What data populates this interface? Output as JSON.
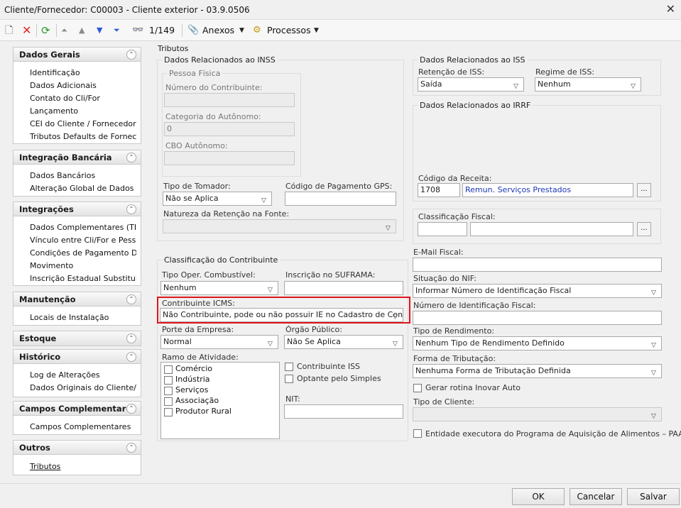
{
  "window": {
    "title": "Cliente/Fornecedor: C00003 - Cliente exterior - 03.9.0506"
  },
  "toolbar": {
    "record_position": "1/149",
    "attachments_label": "Anexos",
    "processes_label": "Processos"
  },
  "sidebar": {
    "sections": [
      {
        "title": "Dados Gerais",
        "items": [
          "Identificação",
          "Dados Adicionais",
          "Contato do Cli/For",
          "Lançamento",
          "CEI do Cliente / Fornecedor",
          "Tributos Defaults de Fornec..."
        ]
      },
      {
        "title": "Integração Bancária",
        "items": [
          "Dados Bancários",
          "Alteração Global de Dados B..."
        ]
      },
      {
        "title": "Integrações",
        "items": [
          "Dados Complementares (TIN)",
          "Vínculo entre Cli/For e Pessoa",
          "Condições de Pagamento De...",
          "Movimento",
          "Inscrição Estadual Substituiç..."
        ]
      },
      {
        "title": "Manutenção",
        "items": [
          "Locais de Instalação"
        ]
      },
      {
        "title": "Estoque",
        "items": []
      },
      {
        "title": "Histórico",
        "items": [
          "Log de Alterações",
          "Dados Originais do Cliente/F..."
        ]
      },
      {
        "title": "Campos Complementares",
        "items": [
          "Campos Complementares"
        ]
      },
      {
        "title": "Outros",
        "items": [
          "Tributos"
        ]
      }
    ]
  },
  "main": {
    "title": "Tributos",
    "inss": {
      "group_title": "Dados Relacionados ao INSS",
      "pf_title": "Pessoa Física",
      "num_contrib_label": "Número do Contribuinte:",
      "num_contrib_value": "",
      "cat_autonomo_label": "Categoria do Autônomo:",
      "cat_autonomo_value": "0",
      "cbo_label": "CBO Autônomo:",
      "cbo_value": "",
      "tomador_label": "Tipo de Tomador:",
      "tomador_value": "Não se Aplica",
      "gps_label": "Código de Pagamento GPS:",
      "gps_value": "",
      "natureza_label": "Natureza da Retenção na Fonte:",
      "natureza_value": ""
    },
    "classif": {
      "group_title": "Classificação do Contribuinte",
      "combustivel_label": "Tipo Oper. Combustível:",
      "combustivel_value": "Nenhum",
      "suframa_label": "Inscrição no SUFRAMA:",
      "suframa_value": "",
      "icms_label": "Contribuinte ICMS:",
      "icms_value": "Não Contribuinte, pode ou não possuir IE no Cadastro de Contribu",
      "porte_label": "Porte da Empresa:",
      "porte_value": "Normal",
      "orgao_label": "Órgão Público:",
      "orgao_value": "Não Se Aplica",
      "ramo_label": "Ramo de Atividade:",
      "ramos": [
        "Comércio",
        "Indústria",
        "Serviços",
        "Associação",
        "Produtor Rural"
      ],
      "contrib_iss_label": "Contribuinte ISS",
      "simples_label": "Optante pelo Simples",
      "nit_label": "NIT:",
      "nit_value": ""
    },
    "iss": {
      "group_title": "Dados Relacionados ao ISS",
      "retencao_label": "Retenção de ISS:",
      "retencao_value": "Saída",
      "regime_label": "Regime de ISS:",
      "regime_value": "Nenhum"
    },
    "irrf": {
      "group_title": "Dados Relacionados ao IRRF",
      "codigo_label": "Código da Receita:",
      "codigo_value": "1708",
      "codigo_desc": "Remun. Serviços Prestados"
    },
    "fiscal": {
      "classif_label": "Classificação Fiscal:",
      "classif_code": "",
      "classif_desc": "",
      "email_label": "E-Mail Fiscal:",
      "email_value": "",
      "nif_situacao_label": "Situação do NIF:",
      "nif_situacao_value": "Informar Número de Identificação Fiscal",
      "nif_num_label": "Número de Identificação Fiscal:",
      "nif_num_value": "",
      "rendimento_label": "Tipo de Rendimento:",
      "rendimento_value": "Nenhum Tipo de Rendimento Definido",
      "tributacao_label": "Forma de Tributação:",
      "tributacao_value": "Nenhuma Forma de Tributação Definida",
      "inovar_label": "Gerar rotina Inovar Auto",
      "tipo_cliente_label": "Tipo de Cliente:",
      "tipo_cliente_value": "",
      "paa_label": "Entidade executora do Programa de Aquisição de Alimentos – PAA"
    }
  },
  "footer": {
    "ok": "OK",
    "cancel": "Cancelar",
    "save": "Salvar"
  },
  "colors": {
    "highlight": "#e0161b",
    "link": "#1a37b6"
  }
}
